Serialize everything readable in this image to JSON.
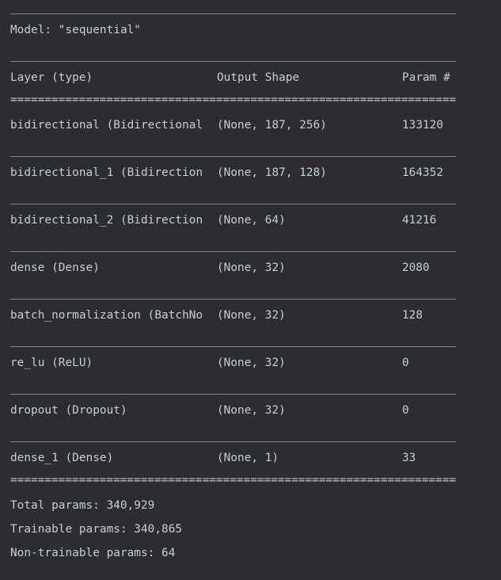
{
  "summary": {
    "dash_rule": "_________________________________________________________________",
    "eq_rule": "=================================================================",
    "model_line": "Model: \"sequential\"",
    "headers": {
      "layer": "Layer (type)",
      "output": "Output Shape",
      "params": "Param #"
    },
    "rows": [
      {
        "layer": "bidirectional (Bidirectional",
        "output": "(None, 187, 256)",
        "params": "133120"
      },
      {
        "layer": "bidirectional_1 (Bidirection",
        "output": "(None, 187, 128)",
        "params": "164352"
      },
      {
        "layer": "bidirectional_2 (Bidirection",
        "output": "(None, 64)",
        "params": "41216"
      },
      {
        "layer": "dense (Dense)",
        "output": "(None, 32)",
        "params": "2080"
      },
      {
        "layer": "batch_normalization (BatchNo",
        "output": "(None, 32)",
        "params": "128"
      },
      {
        "layer": "re_lu (ReLU)",
        "output": "(None, 32)",
        "params": "0"
      },
      {
        "layer": "dropout (Dropout)",
        "output": "(None, 32)",
        "params": "0"
      },
      {
        "layer": "dense_1 (Dense)",
        "output": "(None, 1)",
        "params": "33"
      }
    ],
    "total_params": "Total params: 340,929",
    "trainable_params": "Trainable params: 340,865",
    "non_trainable_params": "Non-trainable params: 64"
  },
  "colors": {
    "background": "#2b2d30",
    "text": "#c9cdd3"
  }
}
